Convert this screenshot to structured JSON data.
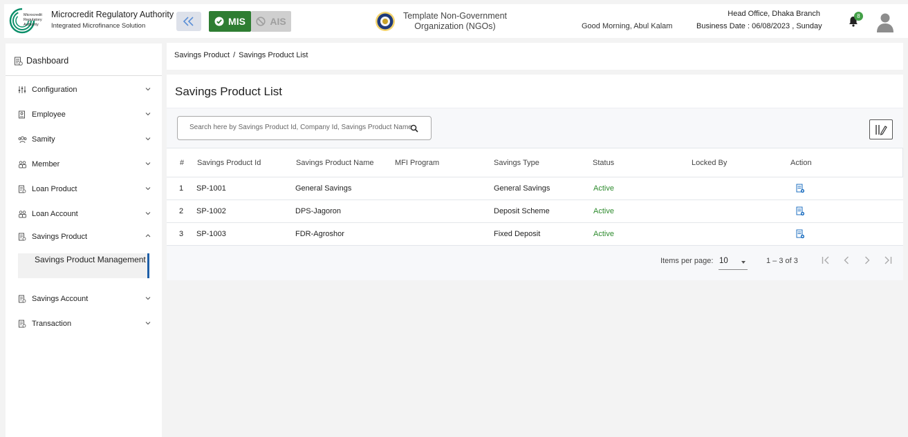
{
  "header": {
    "brand_title": "Microcredit Regulatory Authority",
    "brand_subtitle": "Integrated Microfinance Solution",
    "logo_text": [
      "Microcredit",
      "Regulatory",
      "Authority"
    ],
    "mis_label": "MIS",
    "ais_label": "AIS",
    "org_name_line1": "Template Non-Government",
    "org_name_line2": "Organization (NGOs)",
    "greeting": "Good Morning, Abul Kalam",
    "branch": "Head Office, Dhaka Branch",
    "business_date": "Business Date : 06/08/2023 , Sunday",
    "notification_count": "8",
    "icons": {
      "collapse": "double-chevron-left-icon",
      "mis": "check-circle-icon",
      "ais": "block-icon",
      "notifications": "bell-icon",
      "user": "user-avatar-icon"
    },
    "colors": {
      "mis": "#2e7d32",
      "badge": "#43a047"
    }
  },
  "sidebar": {
    "dashboard_label": "Dashboard",
    "items": [
      {
        "label": "Configuration",
        "icon": "sliders-icon",
        "expanded": false
      },
      {
        "label": "Employee",
        "icon": "id-card-icon",
        "expanded": false
      },
      {
        "label": "Samity",
        "icon": "group-icon",
        "expanded": false
      },
      {
        "label": "Member",
        "icon": "members-icon",
        "expanded": false
      },
      {
        "label": "Loan Product",
        "icon": "document-icon",
        "expanded": false
      },
      {
        "label": "Loan Account",
        "icon": "members-icon",
        "expanded": false
      },
      {
        "label": "Savings Product",
        "icon": "document-icon",
        "expanded": true
      },
      {
        "label": "Savings Account",
        "icon": "document-icon",
        "expanded": false
      },
      {
        "label": "Transaction",
        "icon": "document-icon",
        "expanded": false
      }
    ],
    "active_sub_item": "Savings Product Management",
    "active_color": "#1e5fa8"
  },
  "breadcrumb": {
    "parent": "Savings Product",
    "separator": "/",
    "current": "Savings Product List"
  },
  "page": {
    "title": "Savings Product List",
    "search_placeholder": "Search here by Savings Product Id, Company Id, Savings Product Name"
  },
  "table": {
    "columns": [
      "#",
      "Savings Product Id",
      "Savings Product Name",
      "MFI Program",
      "Savings Type",
      "Status",
      "Locked By",
      "Action"
    ],
    "rows": [
      {
        "no": "1",
        "id": "SP-1001",
        "name": "General Savings",
        "program": "",
        "type": "General Savings",
        "status": "Active",
        "locked_by": ""
      },
      {
        "no": "2",
        "id": "SP-1002",
        "name": "DPS-Jagoron",
        "program": "",
        "type": "Deposit Scheme",
        "status": "Active",
        "locked_by": ""
      },
      {
        "no": "3",
        "id": "SP-1003",
        "name": "FDR-Agroshor",
        "program": "",
        "type": "Fixed Deposit",
        "status": "Active",
        "locked_by": ""
      }
    ],
    "action_icon": "edit-document-icon",
    "status_color": "#2e8b2e"
  },
  "pager": {
    "items_per_page_label": "Items per page:",
    "items_per_page": "10",
    "range": "1 – 3 of 3"
  }
}
